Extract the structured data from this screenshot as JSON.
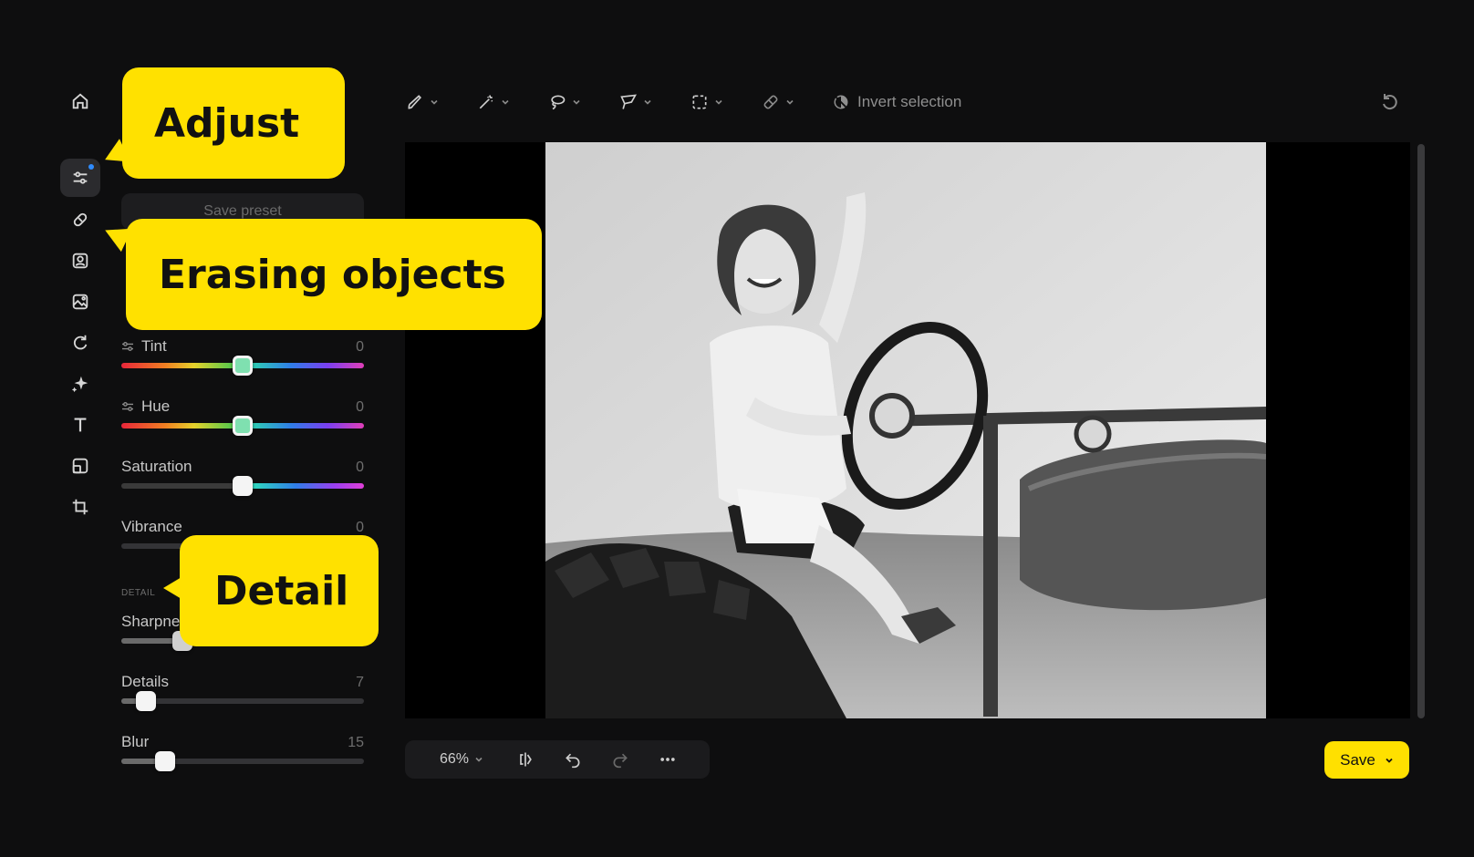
{
  "callouts": {
    "adjust": "Adjust",
    "erasing": "Erasing objects",
    "detail": "Detail"
  },
  "panel": {
    "save_preset": "Save preset",
    "section_detail": "DETAIL",
    "sliders": [
      {
        "label": "Tint",
        "value": "0",
        "level": 0.5
      },
      {
        "label": "Hue",
        "value": "0",
        "level": 0.5
      },
      {
        "label": "Saturation",
        "value": "0",
        "level": 0.5
      },
      {
        "label": "Vibrance",
        "value": "0",
        "level": 0.5
      },
      {
        "label": "Sharpne",
        "value": "",
        "level": 0.25
      },
      {
        "label": "Details",
        "value": "7",
        "level": 0.1
      },
      {
        "label": "Blur",
        "value": "15",
        "level": 0.18
      }
    ]
  },
  "toolbar": {
    "invert_selection": "Invert selection"
  },
  "bottom": {
    "zoom": "66%",
    "save": "Save"
  },
  "icons": {
    "rail": [
      "home-icon",
      "adjust-sliders-icon",
      "eraser-icon",
      "portrait-icon",
      "image-edit-icon",
      "rotate-icon",
      "sparkle-icon",
      "text-icon",
      "layout-icon",
      "crop-icon"
    ],
    "tools": [
      "brush-icon",
      "magic-wand-icon",
      "lasso-icon",
      "polygon-lasso-icon",
      "rect-select-icon",
      "eraser-icon"
    ]
  },
  "colors": {
    "accent": "#ffe000",
    "active_dot": "#2f8cff"
  }
}
